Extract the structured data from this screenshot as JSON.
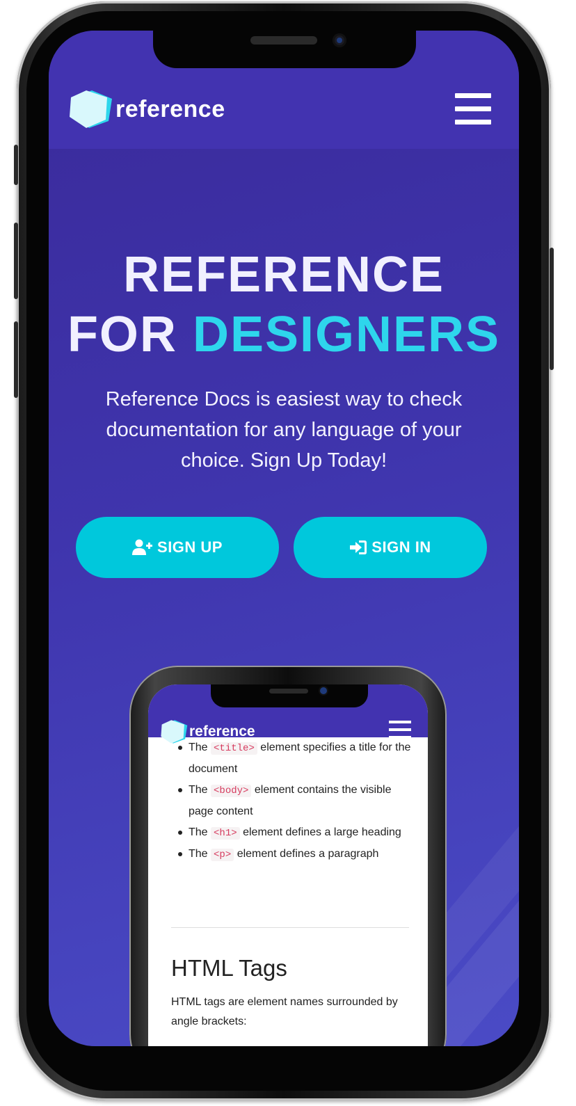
{
  "brand": {
    "name": "reference"
  },
  "header": {
    "menu_icon": "hamburger-menu-icon"
  },
  "hero": {
    "title_line1": "REFERENCE",
    "title_line2_prefix": "FOR",
    "title_line2_accent": "DESIGNERS",
    "subtitle": "Reference Docs is easiest way to check documentation for any language of your choice. Sign Up Today!"
  },
  "buttons": {
    "signup": {
      "label": "SIGN UP",
      "icon": "user-plus-icon"
    },
    "signin": {
      "label": "SIGN IN",
      "icon": "sign-in-icon"
    }
  },
  "mockup": {
    "brand": "reference",
    "list": [
      {
        "prefix": "The",
        "tag": "<title>",
        "text": "element specifies a title for the document"
      },
      {
        "prefix": "The",
        "tag": "<body>",
        "text": "element contains the visible page content"
      },
      {
        "prefix": "The",
        "tag": "<h1>",
        "text": "element defines a large heading"
      },
      {
        "prefix": "The",
        "tag": "<p>",
        "text": "element defines a paragraph"
      }
    ],
    "section_title": "HTML Tags",
    "section_text": "HTML tags are element names surrounded by angle brackets:"
  },
  "colors": {
    "header_bg": "#4233b0",
    "accent": "#2ed6ec",
    "button_bg": "#00c8dc",
    "tag_color": "#d63b5e"
  }
}
